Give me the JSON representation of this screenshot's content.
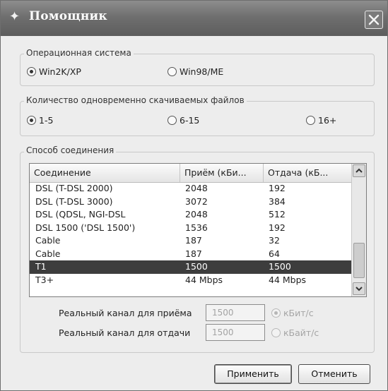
{
  "window": {
    "title": "Помощник"
  },
  "os_group": {
    "label": "Операционная система",
    "options": [
      {
        "label": "Win2K/XP",
        "selected": true
      },
      {
        "label": "Win98/ME",
        "selected": false
      }
    ]
  },
  "files_group": {
    "label": "Количество одновременно скачиваемых файлов",
    "options": [
      {
        "label": "1-5",
        "selected": true
      },
      {
        "label": "6-15",
        "selected": false
      },
      {
        "label": "16+",
        "selected": false
      }
    ]
  },
  "connection_group": {
    "label": "Способ соединения",
    "columns": [
      "Соединение",
      "Приём (кБи...",
      "Отдача (кБ..."
    ],
    "rows": [
      {
        "name": "DSL (T-DSL 2000)",
        "down": "2048",
        "up": "192",
        "selected": false
      },
      {
        "name": "DSL (T-DSL 3000)",
        "down": "3072",
        "up": "384",
        "selected": false
      },
      {
        "name": "DSL (QDSL, NGI-DSL",
        "down": "2048",
        "up": "512",
        "selected": false
      },
      {
        "name": "DSL 1500 ('DSL 1500')",
        "down": "1536",
        "up": "192",
        "selected": false
      },
      {
        "name": "Cable",
        "down": "187",
        "up": "32",
        "selected": false
      },
      {
        "name": "Cable",
        "down": "187",
        "up": "64",
        "selected": false
      },
      {
        "name": "T1",
        "down": "1500",
        "up": "1500",
        "selected": true
      },
      {
        "name": "T3+",
        "down": "44 Mbps",
        "up": "44 Mbps",
        "selected": false
      }
    ],
    "real_down_label": "Реальный канал для приёма",
    "real_down_value": "1500",
    "real_up_label": "Реальный канал для отдачи",
    "real_up_value": "1500",
    "unit_options": [
      {
        "label": "кБит/с",
        "selected": true
      },
      {
        "label": "кБайт/с",
        "selected": false
      }
    ]
  },
  "buttons": {
    "apply": "Применить",
    "cancel": "Отменить"
  },
  "icons": {
    "title": "wand-icon",
    "close": "close-icon"
  }
}
